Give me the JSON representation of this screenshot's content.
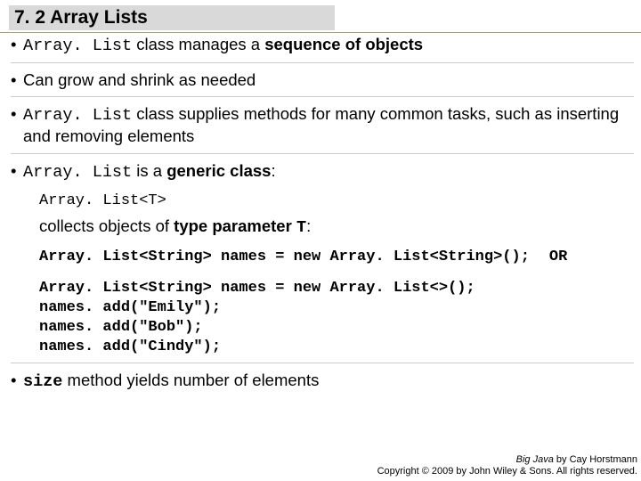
{
  "heading": "7. 2 Array Lists",
  "bullets": {
    "b1_pre": "Array. List",
    "b1_post": " class manages a ",
    "b1_bold": "sequence of objects",
    "b2": "Can grow and shrink as needed",
    "b3_pre": "Array. List",
    "b3_post": " class supplies methods for many common tasks, such as inserting and removing elements",
    "b4_pre": "Array. List",
    "b4_mid": " is a ",
    "b4_bold": "generic class",
    "b4_post": ":",
    "b5_pre": "size",
    "b5_post": " method yields number of elements"
  },
  "generic_example": "Array. List<T>",
  "collects_pre": "collects objects of ",
  "collects_bold": "type parameter ",
  "collects_mono": "T",
  "collects_post": ":",
  "code1": "Array. List<String> names = new Array. List<String>();",
  "or": "OR",
  "code2_l1": "Array. List<String> names = new Array. List<>();",
  "code2_l2": "names. add(\"Emily\");",
  "code2_l3": "names. add(\"Bob\");",
  "code2_l4": "names. add(\"Cindy\");",
  "footer": {
    "line1_italic": "Big Java",
    "line1_rest": " by Cay Horstmann",
    "line2": "Copyright © 2009 by John Wiley & Sons. All rights reserved."
  }
}
